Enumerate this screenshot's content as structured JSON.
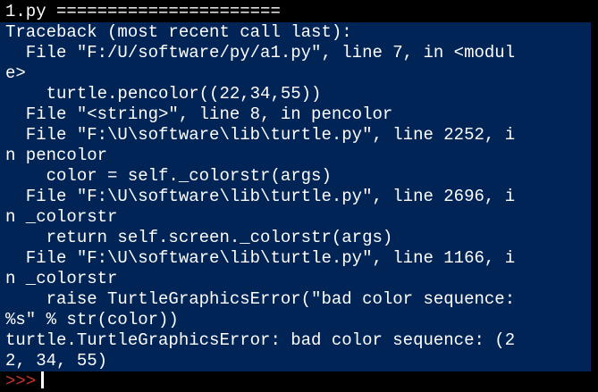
{
  "header": {
    "title": "1.py ======================"
  },
  "traceback": {
    "lines": [
      "Traceback (most recent call last):",
      "  File \"F:/U/software/py/a1.py\", line 7, in <modul",
      "e>",
      "    turtle.pencolor((22,34,55))",
      "  File \"<string>\", line 8, in pencolor",
      "  File \"F:\\U\\software\\lib\\turtle.py\", line 2252, i",
      "n pencolor",
      "    color = self._colorstr(args)",
      "  File \"F:\\U\\software\\lib\\turtle.py\", line 2696, i",
      "n _colorstr",
      "    return self.screen._colorstr(args)",
      "  File \"F:\\U\\software\\lib\\turtle.py\", line 1166, i",
      "n _colorstr",
      "    raise TurtleGraphicsError(\"bad color sequence:",
      "%s\" % str(color))",
      "turtle.TurtleGraphicsError: bad color sequence: (2",
      "2, 34, 55)"
    ]
  },
  "prompt": {
    "text": ">>>"
  },
  "colors": {
    "background": "#000000",
    "traceback_bg": "#012456",
    "text": "#ffffff",
    "prompt": "#c8352e"
  }
}
